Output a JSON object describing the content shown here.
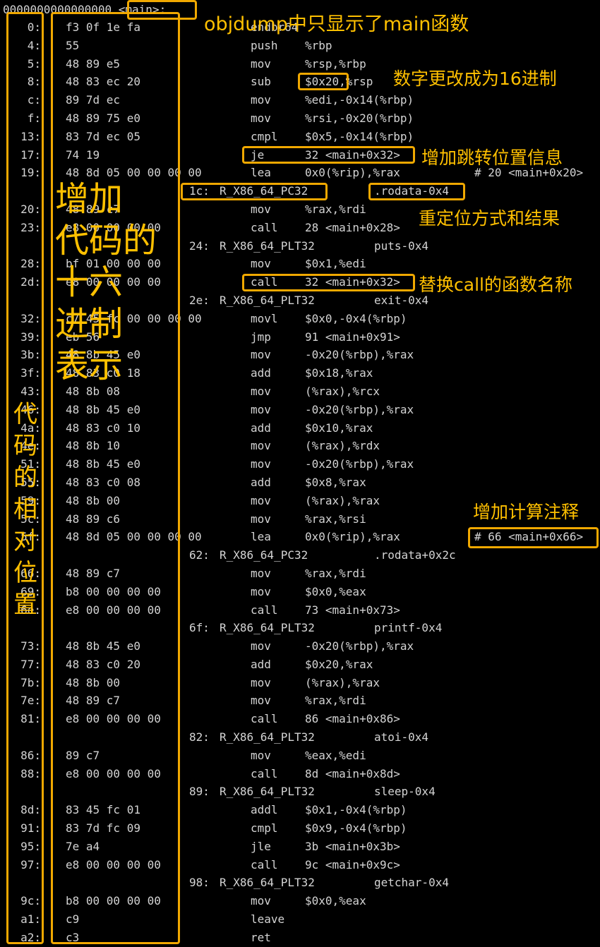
{
  "header": {
    "address": "0000000000000000",
    "label": "<main>:"
  },
  "rows": [
    {
      "type": "ins",
      "addr": "0:",
      "bytes": "f3 0f 1e fa",
      "mn": "endbr64",
      "ops": ""
    },
    {
      "type": "ins",
      "addr": "4:",
      "bytes": "55",
      "mn": "push",
      "ops": "%rbp"
    },
    {
      "type": "ins",
      "addr": "5:",
      "bytes": "48 89 e5",
      "mn": "mov",
      "ops": "%rsp,%rbp"
    },
    {
      "type": "ins",
      "addr": "8:",
      "bytes": "48 83 ec 20",
      "mn": "sub",
      "ops": "$0x20,%rsp"
    },
    {
      "type": "ins",
      "addr": "c:",
      "bytes": "89 7d ec",
      "mn": "mov",
      "ops": "%edi,-0x14(%rbp)"
    },
    {
      "type": "ins",
      "addr": "f:",
      "bytes": "48 89 75 e0",
      "mn": "mov",
      "ops": "%rsi,-0x20(%rbp)"
    },
    {
      "type": "ins",
      "addr": "13:",
      "bytes": "83 7d ec 05",
      "mn": "cmpl",
      "ops": "$0x5,-0x14(%rbp)"
    },
    {
      "type": "ins",
      "addr": "17:",
      "bytes": "74 19",
      "mn": "je",
      "ops": "32 <main+0x32>"
    },
    {
      "type": "ins",
      "addr": "19:",
      "bytes": "48 8d 05 00 00 00 00",
      "mn": "lea",
      "ops": "0x0(%rip),%rax",
      "cmt": "# 20 <main+0x20>"
    },
    {
      "type": "rel",
      "off": "1c:",
      "rtype": "R_X86_64_PC32",
      "sym": ".rodata-0x4"
    },
    {
      "type": "ins",
      "addr": "20:",
      "bytes": "48 89 c7",
      "mn": "mov",
      "ops": "%rax,%rdi"
    },
    {
      "type": "ins",
      "addr": "23:",
      "bytes": "e8 00 00 00 00",
      "mn": "call",
      "ops": "28 <main+0x28>"
    },
    {
      "type": "rel",
      "off": "24:",
      "rtype": "R_X86_64_PLT32",
      "sym": "puts-0x4"
    },
    {
      "type": "ins",
      "addr": "28:",
      "bytes": "bf 01 00 00 00",
      "mn": "mov",
      "ops": "$0x1,%edi"
    },
    {
      "type": "ins",
      "addr": "2d:",
      "bytes": "e8 00 00 00 00",
      "mn": "call",
      "ops": "32 <main+0x32>"
    },
    {
      "type": "rel",
      "off": "2e:",
      "rtype": "R_X86_64_PLT32",
      "sym": "exit-0x4"
    },
    {
      "type": "ins",
      "addr": "32:",
      "bytes": "c7 45 fc 00 00 00 00",
      "mn": "movl",
      "ops": "$0x0,-0x4(%rbp)"
    },
    {
      "type": "ins",
      "addr": "39:",
      "bytes": "eb 56",
      "mn": "jmp",
      "ops": "91 <main+0x91>"
    },
    {
      "type": "ins",
      "addr": "3b:",
      "bytes": "48 8b 45 e0",
      "mn": "mov",
      "ops": "-0x20(%rbp),%rax"
    },
    {
      "type": "ins",
      "addr": "3f:",
      "bytes": "48 83 c0 18",
      "mn": "add",
      "ops": "$0x18,%rax"
    },
    {
      "type": "ins",
      "addr": "43:",
      "bytes": "48 8b 08",
      "mn": "mov",
      "ops": "(%rax),%rcx"
    },
    {
      "type": "ins",
      "addr": "46:",
      "bytes": "48 8b 45 e0",
      "mn": "mov",
      "ops": "-0x20(%rbp),%rax"
    },
    {
      "type": "ins",
      "addr": "4a:",
      "bytes": "48 83 c0 10",
      "mn": "add",
      "ops": "$0x10,%rax"
    },
    {
      "type": "ins",
      "addr": "4e:",
      "bytes": "48 8b 10",
      "mn": "mov",
      "ops": "(%rax),%rdx"
    },
    {
      "type": "ins",
      "addr": "51:",
      "bytes": "48 8b 45 e0",
      "mn": "mov",
      "ops": "-0x20(%rbp),%rax"
    },
    {
      "type": "ins",
      "addr": "55:",
      "bytes": "48 83 c0 08",
      "mn": "add",
      "ops": "$0x8,%rax"
    },
    {
      "type": "ins",
      "addr": "59:",
      "bytes": "48 8b 00",
      "mn": "mov",
      "ops": "(%rax),%rax"
    },
    {
      "type": "ins",
      "addr": "5c:",
      "bytes": "48 89 c6",
      "mn": "mov",
      "ops": "%rax,%rsi"
    },
    {
      "type": "ins",
      "addr": "5f:",
      "bytes": "48 8d 05 00 00 00 00",
      "mn": "lea",
      "ops": "0x0(%rip),%rax",
      "cmt": "# 66 <main+0x66>"
    },
    {
      "type": "rel",
      "off": "62:",
      "rtype": "R_X86_64_PC32",
      "sym": ".rodata+0x2c"
    },
    {
      "type": "ins",
      "addr": "66:",
      "bytes": "48 89 c7",
      "mn": "mov",
      "ops": "%rax,%rdi"
    },
    {
      "type": "ins",
      "addr": "69:",
      "bytes": "b8 00 00 00 00",
      "mn": "mov",
      "ops": "$0x0,%eax"
    },
    {
      "type": "ins",
      "addr": "6e:",
      "bytes": "e8 00 00 00 00",
      "mn": "call",
      "ops": "73 <main+0x73>"
    },
    {
      "type": "rel",
      "off": "6f:",
      "rtype": "R_X86_64_PLT32",
      "sym": "printf-0x4"
    },
    {
      "type": "ins",
      "addr": "73:",
      "bytes": "48 8b 45 e0",
      "mn": "mov",
      "ops": "-0x20(%rbp),%rax"
    },
    {
      "type": "ins",
      "addr": "77:",
      "bytes": "48 83 c0 20",
      "mn": "add",
      "ops": "$0x20,%rax"
    },
    {
      "type": "ins",
      "addr": "7b:",
      "bytes": "48 8b 00",
      "mn": "mov",
      "ops": "(%rax),%rax"
    },
    {
      "type": "ins",
      "addr": "7e:",
      "bytes": "48 89 c7",
      "mn": "mov",
      "ops": "%rax,%rdi"
    },
    {
      "type": "ins",
      "addr": "81:",
      "bytes": "e8 00 00 00 00",
      "mn": "call",
      "ops": "86 <main+0x86>"
    },
    {
      "type": "rel",
      "off": "82:",
      "rtype": "R_X86_64_PLT32",
      "sym": "atoi-0x4"
    },
    {
      "type": "ins",
      "addr": "86:",
      "bytes": "89 c7",
      "mn": "mov",
      "ops": "%eax,%edi"
    },
    {
      "type": "ins",
      "addr": "88:",
      "bytes": "e8 00 00 00 00",
      "mn": "call",
      "ops": "8d <main+0x8d>"
    },
    {
      "type": "rel",
      "off": "89:",
      "rtype": "R_X86_64_PLT32",
      "sym": "sleep-0x4"
    },
    {
      "type": "ins",
      "addr": "8d:",
      "bytes": "83 45 fc 01",
      "mn": "addl",
      "ops": "$0x1,-0x4(%rbp)"
    },
    {
      "type": "ins",
      "addr": "91:",
      "bytes": "83 7d fc 09",
      "mn": "cmpl",
      "ops": "$0x9,-0x4(%rbp)"
    },
    {
      "type": "ins",
      "addr": "95:",
      "bytes": "7e a4",
      "mn": "jle",
      "ops": "3b <main+0x3b>"
    },
    {
      "type": "ins",
      "addr": "97:",
      "bytes": "e8 00 00 00 00",
      "mn": "call",
      "ops": "9c <main+0x9c>"
    },
    {
      "type": "rel",
      "off": "98:",
      "rtype": "R_X86_64_PLT32",
      "sym": "getchar-0x4"
    },
    {
      "type": "ins",
      "addr": "9c:",
      "bytes": "b8 00 00 00 00",
      "mn": "mov",
      "ops": "$0x0,%eax"
    },
    {
      "type": "ins",
      "addr": "a1:",
      "bytes": "c9",
      "mn": "leave",
      "ops": ""
    },
    {
      "type": "ins",
      "addr": "a2:",
      "bytes": "c3",
      "mn": "ret",
      "ops": ""
    }
  ],
  "annotations": {
    "main_only": "objdump中只显示了main函数",
    "hex_number": "数字更改成为16进制",
    "jump_info": "增加跳转位置信息",
    "reloc": "重定位方式和结果",
    "call_name": "替换call的函数名称",
    "calc_comment": "增加计算注释",
    "hex_code": [
      "增加",
      "代码的",
      "十六",
      "进制",
      "表示"
    ],
    "relative_pos": [
      "代",
      "码",
      "的",
      "相",
      "对",
      "位",
      "置"
    ]
  },
  "colors": {
    "background": "#000000",
    "text": "#d4d4d4",
    "highlight": "#f0a800",
    "annotation": "#ffc000"
  }
}
